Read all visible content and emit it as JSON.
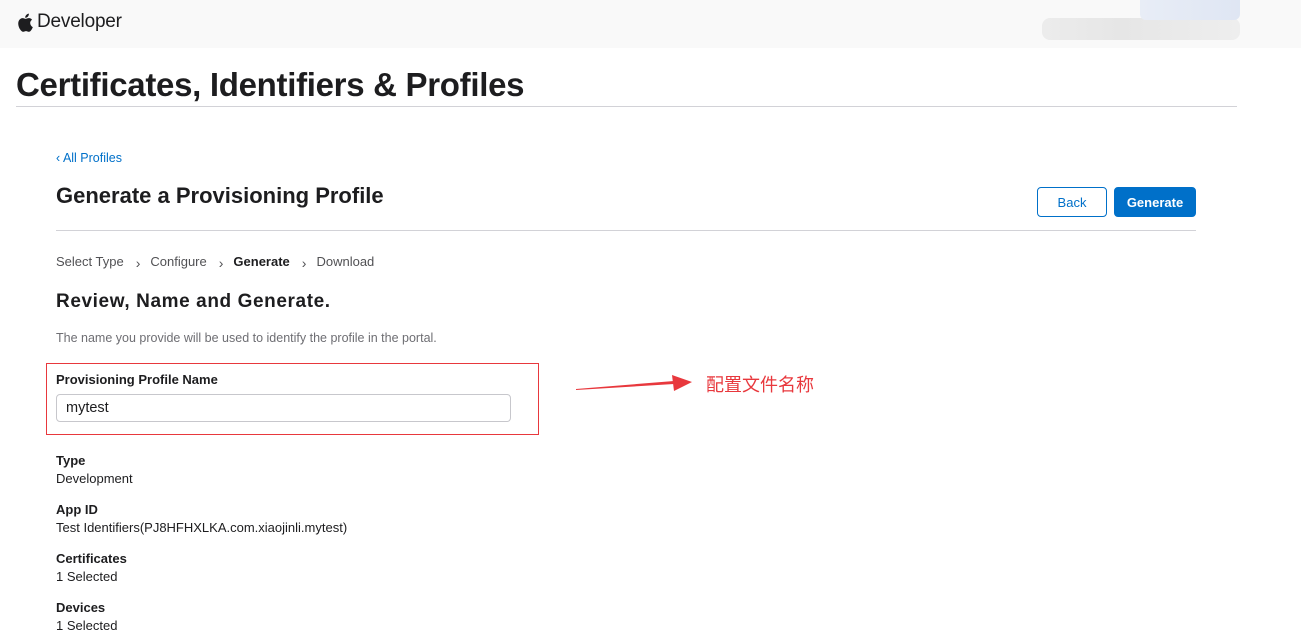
{
  "header": {
    "brand_name": "Developer",
    "page_title": "Certificates, Identifiers & Profiles"
  },
  "nav": {
    "back_link": "‹ All Profiles"
  },
  "section": {
    "title": "Generate a Provisioning Profile",
    "back_button": "Back",
    "generate_button": "Generate"
  },
  "steps": [
    {
      "label": "Select Type",
      "current": false
    },
    {
      "label": "Configure",
      "current": false
    },
    {
      "label": "Generate",
      "current": true
    },
    {
      "label": "Download",
      "current": false
    }
  ],
  "review": {
    "title": "Review, Name and Generate.",
    "hint": "The name you provide will be used to identify the profile in the portal.",
    "field_label": "Provisioning Profile Name",
    "field_value": "mytest"
  },
  "annotation": {
    "text": "配置文件名称",
    "color": "#e8383d"
  },
  "details": {
    "type_label": "Type",
    "type_value": "Development",
    "appid_label": "App ID",
    "appid_value": "Test Identifiers(PJ8HFHXLKA.com.xiaojinli.mytest)",
    "certificates_label": "Certificates",
    "certificates_value": "1 Selected",
    "devices_label": "Devices",
    "devices_value": "1 Selected"
  },
  "colors": {
    "accent": "#0070c9",
    "annotation_red": "#e8383d"
  }
}
